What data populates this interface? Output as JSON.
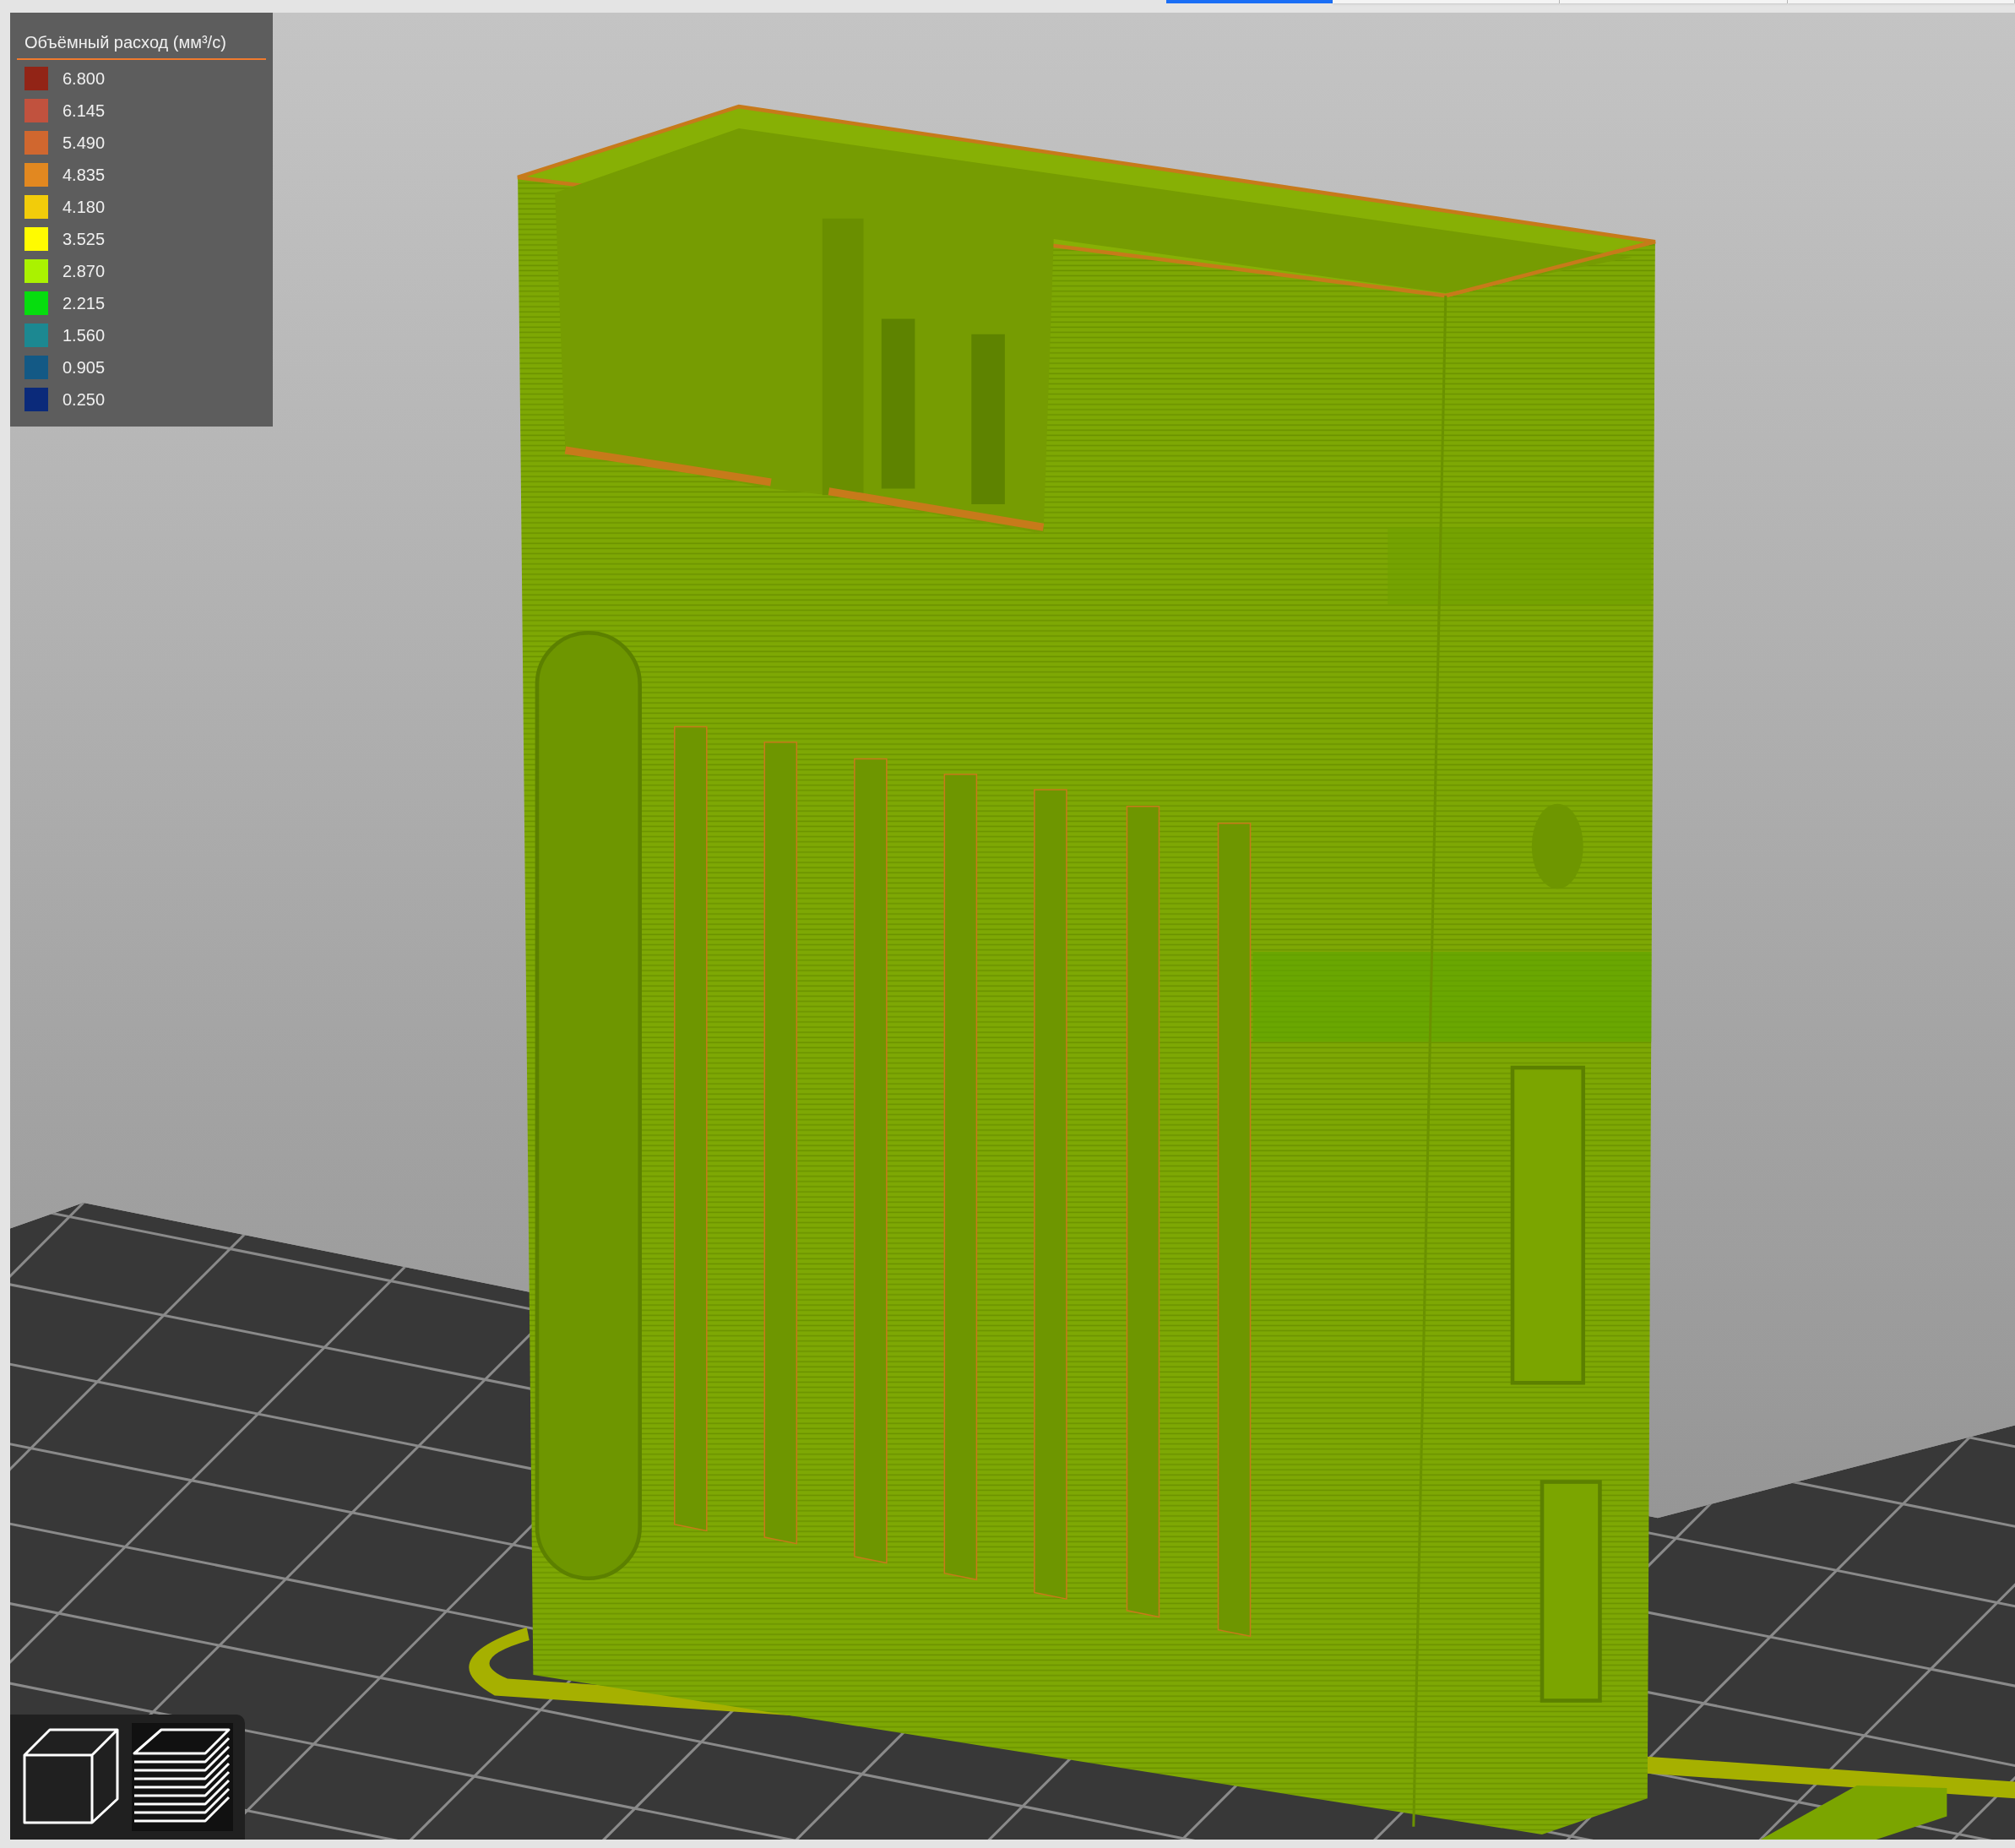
{
  "top_tabs": [
    {
      "selected": true
    },
    {
      "selected": false
    },
    {
      "selected": false
    },
    {
      "selected": false
    }
  ],
  "legend": {
    "title": "Объёмный расход (мм³/с)",
    "items": [
      {
        "value": "6.800",
        "color": "#922416"
      },
      {
        "value": "6.145",
        "color": "#c1523e"
      },
      {
        "value": "5.490",
        "color": "#d0672f"
      },
      {
        "value": "4.835",
        "color": "#e28820"
      },
      {
        "value": "4.180",
        "color": "#f2cc0a"
      },
      {
        "value": "3.525",
        "color": "#fffb00"
      },
      {
        "value": "2.870",
        "color": "#aaf200"
      },
      {
        "value": "2.215",
        "color": "#06dd0e"
      },
      {
        "value": "1.560",
        "color": "#1c8891"
      },
      {
        "value": "0.905",
        "color": "#135985"
      },
      {
        "value": "0.250",
        "color": "#0b2a7a"
      }
    ]
  },
  "view_buttons": [
    {
      "kind": "model",
      "selected": false
    },
    {
      "kind": "preview",
      "selected": true
    }
  ]
}
